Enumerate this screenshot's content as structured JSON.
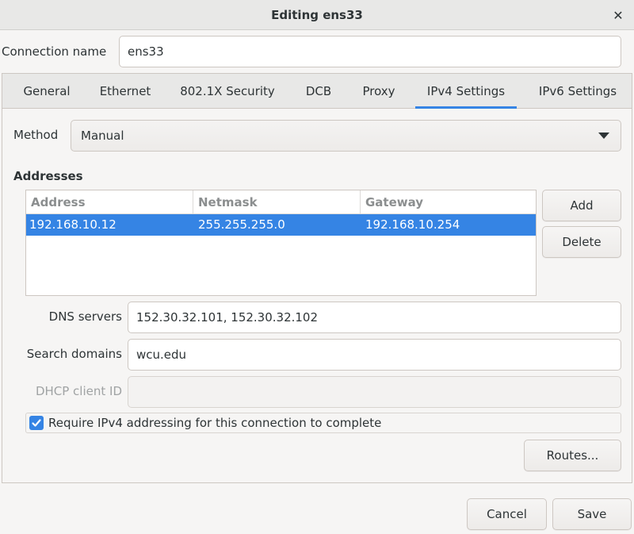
{
  "window": {
    "title": "Editing ens33",
    "close_glyph": "✕"
  },
  "connection": {
    "label": "Connection name",
    "value": "ens33"
  },
  "tabs": [
    {
      "label": "General"
    },
    {
      "label": "Ethernet"
    },
    {
      "label": "802.1X Security"
    },
    {
      "label": "DCB"
    },
    {
      "label": "Proxy"
    },
    {
      "label": "IPv4 Settings",
      "active": true
    },
    {
      "label": "IPv6 Settings"
    }
  ],
  "method": {
    "label": "Method",
    "value": "Manual"
  },
  "addresses": {
    "heading": "Addresses",
    "columns": [
      "Address",
      "Netmask",
      "Gateway"
    ],
    "rows": [
      {
        "address": "192.168.10.12",
        "netmask": "255.255.255.0",
        "gateway": "192.168.10.254",
        "selected": true
      }
    ],
    "add_label": "Add",
    "delete_label": "Delete"
  },
  "dns": {
    "label": "DNS servers",
    "value": "152.30.32.101, 152.30.32.102"
  },
  "search_domains": {
    "label": "Search domains",
    "value": "wcu.edu"
  },
  "dhcp_client_id": {
    "label": "DHCP client ID",
    "value": ""
  },
  "require_ipv4": {
    "label": "Require IPv4 addressing for this connection to complete",
    "checked": true
  },
  "routes_label": "Routes...",
  "footer": {
    "cancel_label": "Cancel",
    "save_label": "Save"
  },
  "colors": {
    "accent": "#3584e4",
    "window_bg": "#f6f5f4"
  },
  "icons": {
    "close": "close-icon",
    "dropdown": "chevron-down-icon",
    "check": "checkmark-icon"
  }
}
